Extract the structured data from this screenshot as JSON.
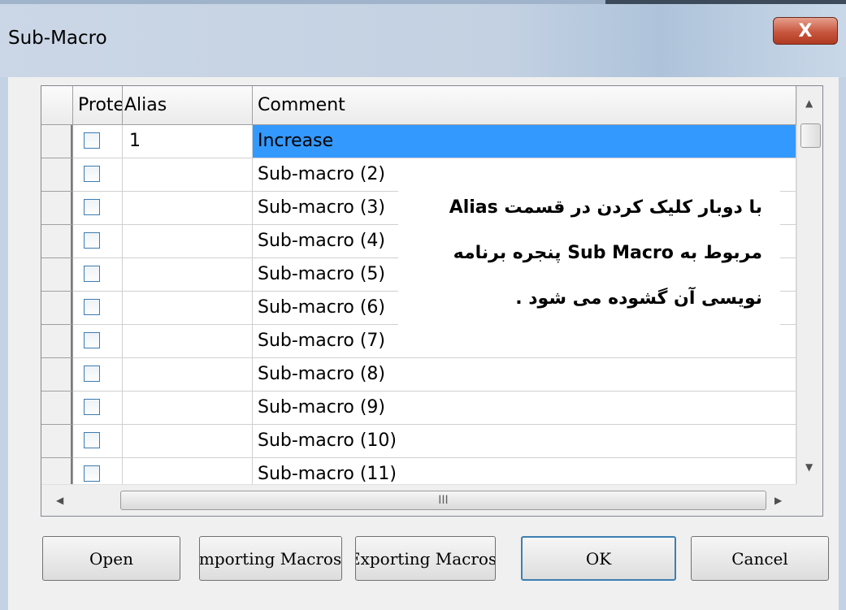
{
  "window": {
    "title": "Sub-Macro",
    "close_icon": "X"
  },
  "grid": {
    "columns": [
      "Prote",
      "Alias",
      "Comment"
    ],
    "rows": [
      {
        "alias": "1",
        "comment": "Increase",
        "selected": true
      },
      {
        "alias": "",
        "comment": "Sub-macro (2)"
      },
      {
        "alias": "",
        "comment": "Sub-macro (3)"
      },
      {
        "alias": "",
        "comment": "Sub-macro (4)"
      },
      {
        "alias": "",
        "comment": "Sub-macro (5)"
      },
      {
        "alias": "",
        "comment": "Sub-macro (6)"
      },
      {
        "alias": "",
        "comment": "Sub-macro (7)"
      },
      {
        "alias": "",
        "comment": "Sub-macro (8)"
      },
      {
        "alias": "",
        "comment": "Sub-macro (9)"
      },
      {
        "alias": "",
        "comment": "Sub-macro (10)"
      },
      {
        "alias": "",
        "comment": "Sub-macro (11)"
      }
    ],
    "hscroll_grip": "III"
  },
  "annotation": {
    "line1": "با دوبار کلیک کردن در قسمت Alias",
    "line2": "مربوط به Sub Macro پنجره برنامه",
    "line3": "نویسی آن گشوده می شود ."
  },
  "buttons": {
    "open": "Open",
    "importing": "Importing Macros",
    "exporting": "Exporting Macros",
    "ok": "OK",
    "cancel": "Cancel"
  },
  "colors": {
    "selection": "#3399ff",
    "close_button": "#c8563e"
  }
}
